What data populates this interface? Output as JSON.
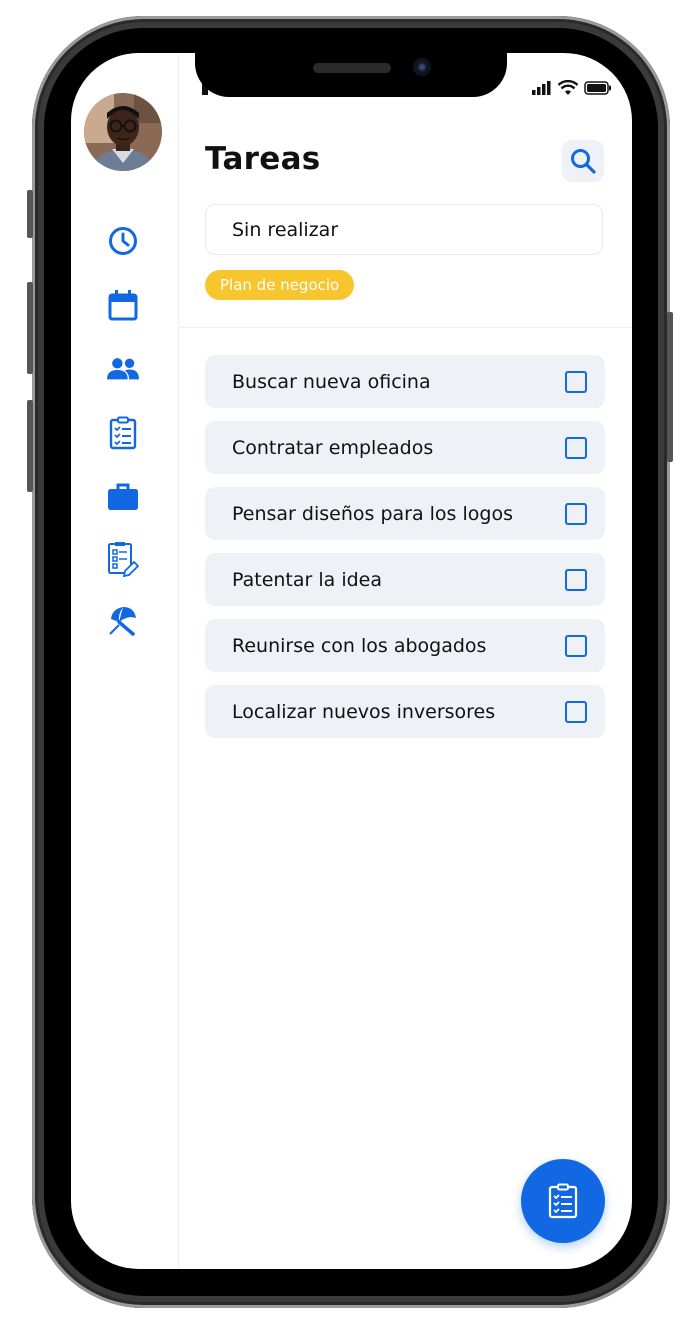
{
  "header": {
    "title": "Tareas"
  },
  "filter": {
    "value": "Sin realizar"
  },
  "tag": {
    "label": "Plan de negocio"
  },
  "tasks": [
    {
      "label": "Buscar nueva oficina",
      "checked": false
    },
    {
      "label": "Contratar empleados",
      "checked": false
    },
    {
      "label": "Pensar diseños para los logos",
      "checked": false
    },
    {
      "label": "Patentar la idea",
      "checked": false
    },
    {
      "label": "Reunirse con los abogados",
      "checked": false
    },
    {
      "label": "Localizar nuevos inversores",
      "checked": false
    }
  ],
  "sidebar": {
    "icons": [
      "clock-icon",
      "calendar-icon",
      "people-icon",
      "checklist-icon",
      "briefcase-icon",
      "report-icon",
      "umbrella-icon"
    ]
  },
  "colors": {
    "accent": "#1268e3",
    "tag": "#f7c52d",
    "task_bg": "#eef2f6"
  }
}
